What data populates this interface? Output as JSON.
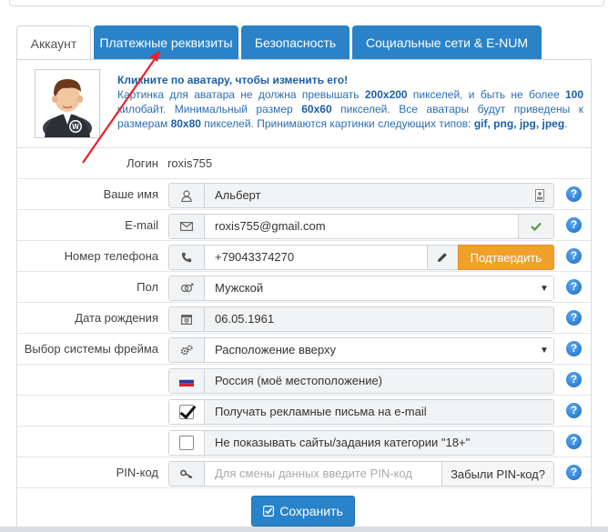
{
  "tabs": [
    {
      "label": "Аккаунт",
      "active": true
    },
    {
      "label": "Платежные реквизиты",
      "active": false
    },
    {
      "label": "Безопасность",
      "active": false
    },
    {
      "label": "Социальные сети & E-NUM",
      "active": false
    }
  ],
  "avatar": {
    "title": "Кликните по аватару, чтобы изменить его!",
    "text1": "Картинка для аватара не должна превышать ",
    "max_size": "200x200",
    "text2": " пикселей, и быть не более ",
    "max_kb": "100",
    "text3": " килобайт. Минимальный размер ",
    "min_size": "60x60",
    "text4": " пикселей. Все аватары будут приведены к размерам ",
    "norm_size": "80x80",
    "text5": " пикселей. Принимаются картинки следующих типов: ",
    "types": "gif, png, jpg, jpeg",
    "text6": "."
  },
  "form": {
    "login": {
      "label": "Логин",
      "value": "roxis755"
    },
    "name": {
      "label": "Ваше имя",
      "value": "Альберт"
    },
    "email": {
      "label": "E-mail",
      "value": "roxis755@gmail.com"
    },
    "phone": {
      "label": "Номер телефона",
      "value": "+79043374270",
      "confirm": "Подтвердить"
    },
    "gender": {
      "label": "Пол",
      "value": "Мужской"
    },
    "birthdate": {
      "label": "Дата рождения",
      "value": "06.05.1961"
    },
    "frame": {
      "label": "Выбор системы фрейма",
      "value": "Расположение вверху"
    },
    "location": {
      "value": "Россия (моё местоположение)"
    },
    "ads": {
      "value": "Получать рекламные письма на e-mail",
      "checked": true
    },
    "adult": {
      "value": "Не показывать сайты/задания категории \"18+\"",
      "checked": false
    },
    "pin": {
      "label": "PIN-код",
      "placeholder": "Для смены данных введите PIN-код",
      "forgot": "Забыли PIN-код?"
    }
  },
  "help_glyph": "?",
  "save_label": "Сохранить",
  "colors": {
    "primary": "#2a83c9",
    "orange": "#f0a12c",
    "link": "#2a6db3",
    "annotation": "#e8212b"
  }
}
